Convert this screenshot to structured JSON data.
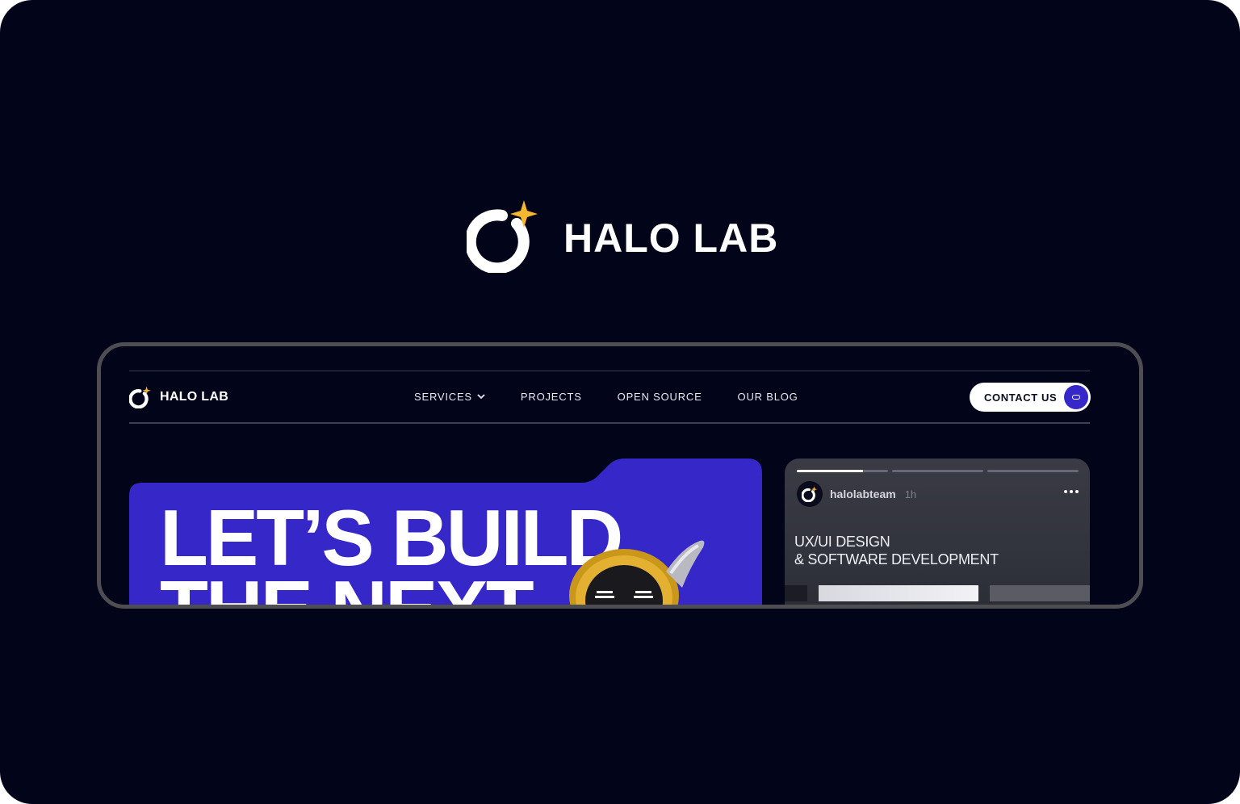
{
  "brand": {
    "name": "HALO LAB",
    "accent_color": "#f5b82e",
    "background": "#02041a"
  },
  "site": {
    "logo_text": "HALO LAB",
    "nav": [
      {
        "label": "SERVICES",
        "icon": "chevron-down-icon"
      },
      {
        "label": "PROJECTS"
      },
      {
        "label": "OPEN SOURCE"
      },
      {
        "label": "OUR BLOG"
      }
    ],
    "contact_label": "CONTACT US",
    "contact_color": "#3627c9"
  },
  "hero": {
    "title_line1": "LET’S BUILD",
    "title_line2": "THE NEXT",
    "panel_color": "#3627c9"
  },
  "story": {
    "progress": [
      0.73,
      0,
      0
    ],
    "username": "halolabteam",
    "time": "1h",
    "title_line1": "UX/UI DESIGN",
    "title_line2": "& SOFTWARE DEVELOPMENT"
  }
}
